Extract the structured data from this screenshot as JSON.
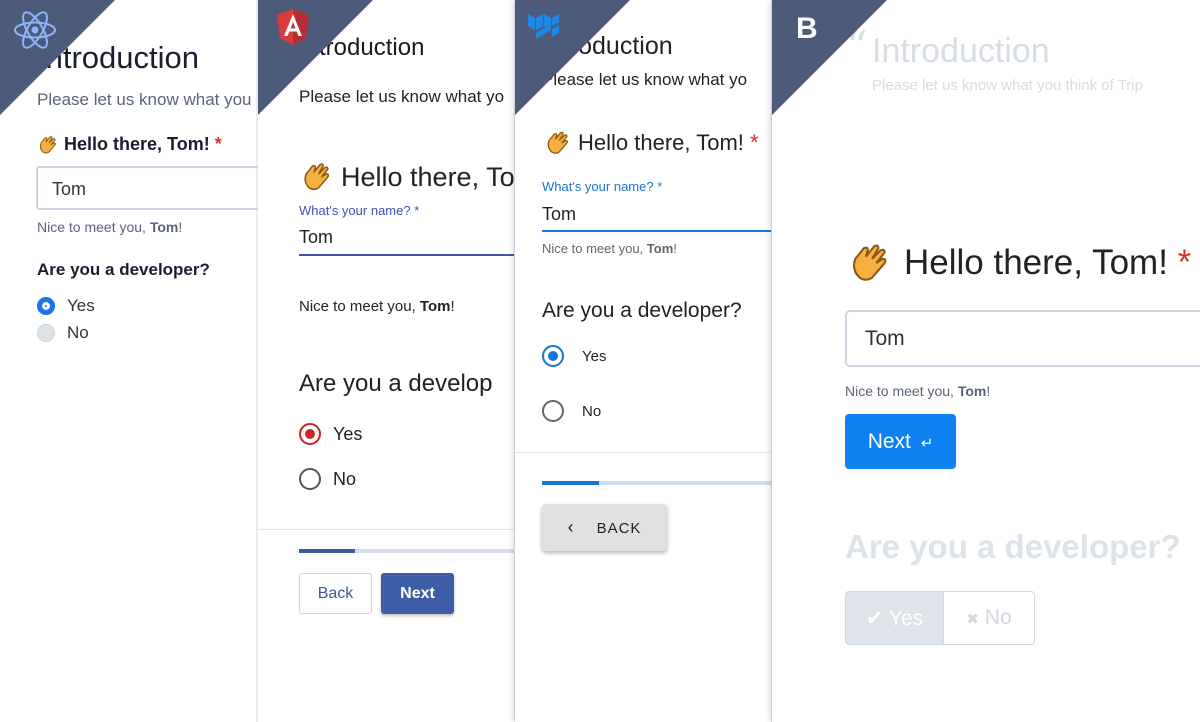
{
  "react": {
    "title": "Introduction",
    "subtitle": "Please let us know what you",
    "hello": "Hello there, Tom!",
    "required_mark": "*",
    "name_value": "Tom",
    "nice_prefix": "Nice to meet you, ",
    "nice_name": "Tom",
    "nice_suffix": "!",
    "question": "Are you a developer?",
    "options": [
      {
        "label": "Yes",
        "selected": true
      },
      {
        "label": "No",
        "selected": false
      }
    ]
  },
  "angular": {
    "title": "Introduction",
    "subtitle": "Please let us know what yo",
    "hello": "Hello there, To",
    "field_label": "What's your name? *",
    "name_value": "Tom",
    "nice_prefix": "Nice to meet you, ",
    "nice_name": "Tom",
    "nice_suffix": "!",
    "question": "Are you a develop",
    "options": [
      {
        "label": "Yes",
        "selected": true
      },
      {
        "label": "No",
        "selected": false
      }
    ],
    "progress": 0.26,
    "back_label": "Back",
    "next_label": "Next"
  },
  "mui": {
    "title": "Introduction",
    "subtitle": "Please let us know what yo",
    "hello": "Hello there, Tom!",
    "required_mark": "*",
    "field_label": "What's your name? *",
    "name_value": "Tom",
    "nice_prefix": "Nice to meet you, ",
    "nice_name": "Tom",
    "nice_suffix": "!",
    "question": "Are you a developer?",
    "options": [
      {
        "label": "Yes",
        "selected": true
      },
      {
        "label": "No",
        "selected": false
      }
    ],
    "progress": 0.25,
    "back_label": "BACK"
  },
  "bootstrap": {
    "brand": "B",
    "title": "Introduction",
    "subtitle": "Please let us know what you think of Trip",
    "hello": "Hello there, Tom!",
    "required_mark": "*",
    "name_value": "Tom",
    "nice_prefix": "Nice to meet you, ",
    "nice_name": "Tom",
    "nice_suffix": "!",
    "next_label": "Next",
    "question": "Are you a developer?",
    "yes_label": "Yes",
    "no_label": "No"
  },
  "colors": {
    "corner": "#4d5b7b",
    "react_accent": "#1a73e8",
    "angular_primary": "#3d5ea6",
    "angular_radio": "#c62828",
    "mui_primary": "#1976d2",
    "bootstrap_primary": "#0d80f2"
  },
  "icons": {
    "react": "react-logo-icon",
    "angular": "angular-logo-icon",
    "mui": "mui-logo-icon",
    "wave": "waving-hand-icon"
  }
}
